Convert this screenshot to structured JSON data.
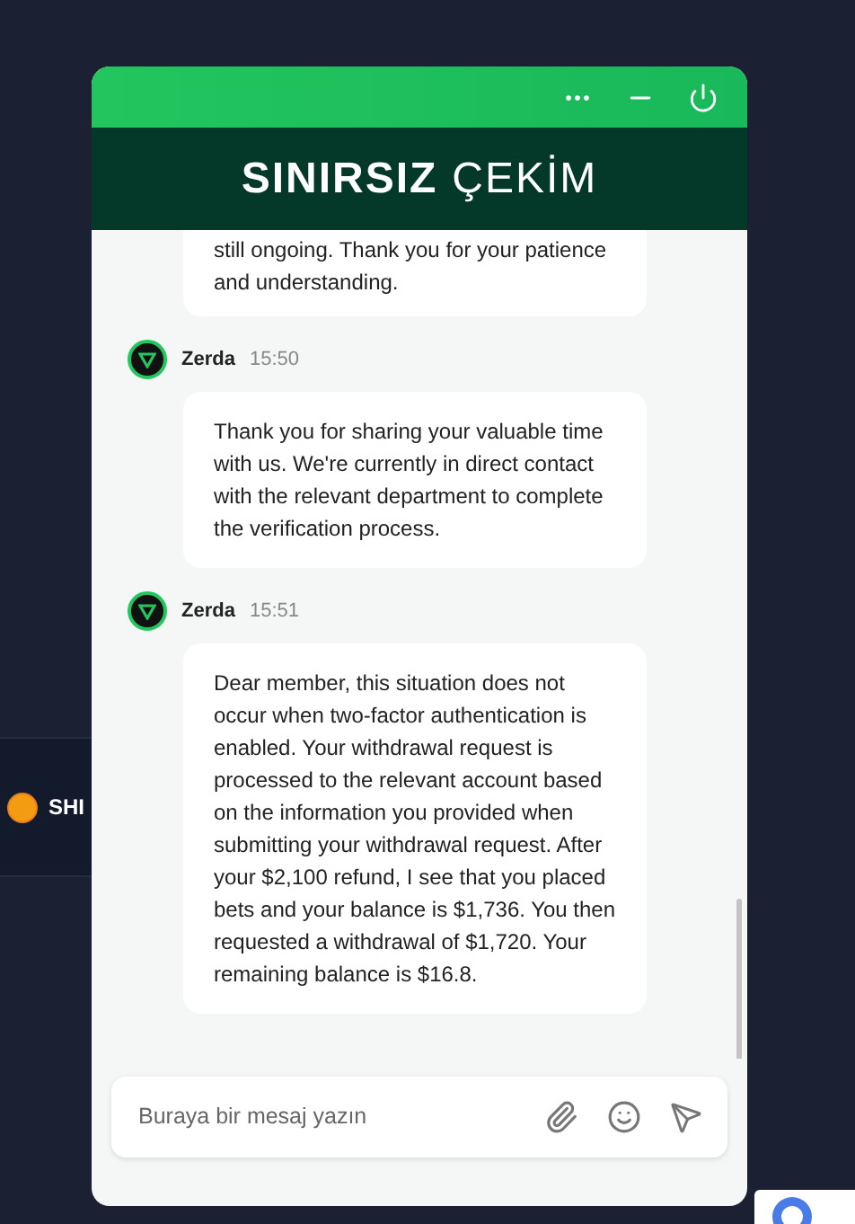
{
  "background": {
    "coin": {
      "symbol": "SHI"
    }
  },
  "chat": {
    "logo": {
      "bold": "SINIRSIZ",
      "light": "ÇEKİM"
    },
    "messages": [
      {
        "lines": "still ongoing. Thank you for your patience and understanding."
      },
      {
        "sender": "Zerda",
        "time": "15:50",
        "lines": "Thank you for sharing your valuable time with us. We're currently in direct contact with the relevant department to complete the verification process."
      },
      {
        "sender": "Zerda",
        "time": "15:51",
        "lines": "Dear member, this situation does not occur when two-factor authentication is enabled. Your withdrawal request is processed to the relevant account based on the information you provided when submitting your withdrawal request. After your $2,100 refund, I see that you placed bets and your balance is $1,736. You then requested a withdrawal of $1,720. Your remaining balance is $16.8."
      }
    ],
    "composer": {
      "placeholder": "Buraya bir mesaj yazın"
    }
  }
}
